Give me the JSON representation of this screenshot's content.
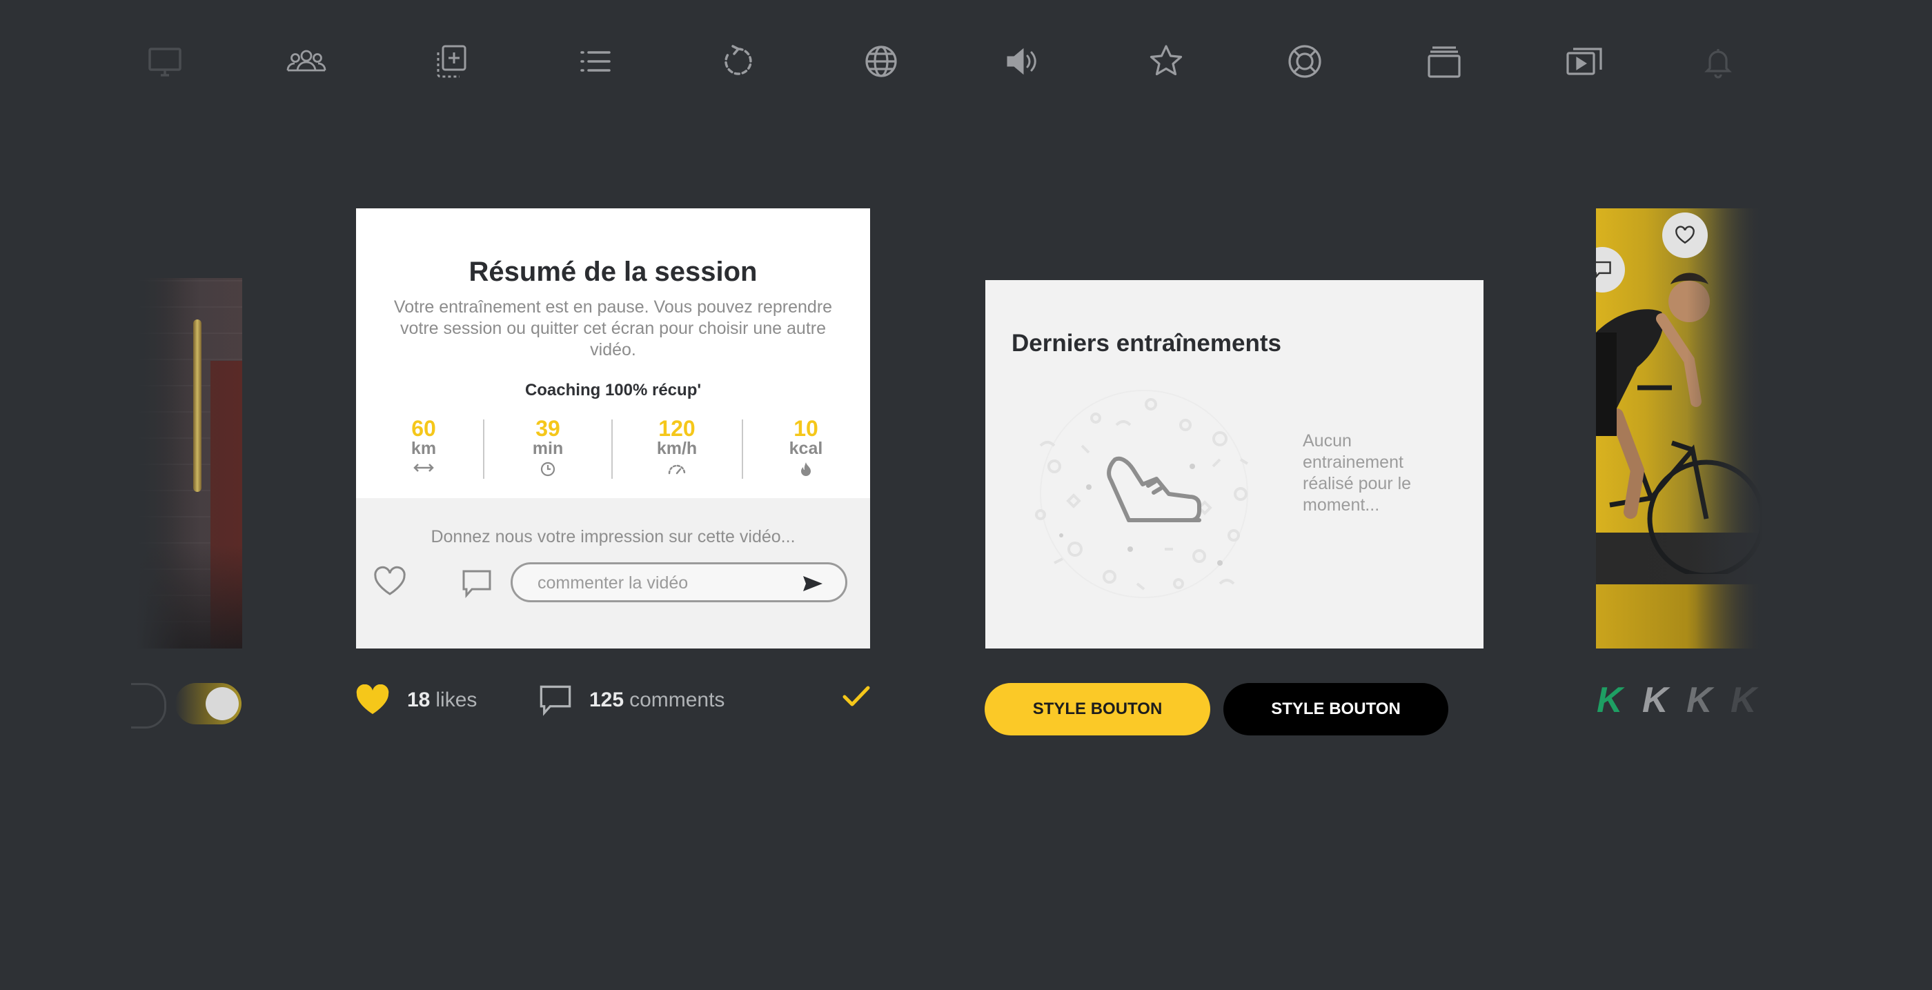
{
  "toolbar": {
    "icons": [
      "monitor-icon",
      "users-icon",
      "add-copy-icon",
      "list-icon",
      "refresh-icon",
      "globe-icon",
      "volume-icon",
      "star-icon",
      "lifebuoy-icon",
      "stack-icon",
      "playlist-icon",
      "bell-icon"
    ]
  },
  "session_card": {
    "title": "Résumé de la session",
    "description": "Votre entraînement est en pause. Vous pouvez reprendre votre session ou quitter cet écran pour choisir une autre vidéo.",
    "coaching": "Coaching 100% récup'",
    "stats": [
      {
        "value": "60",
        "unit": "km",
        "icon": "distance-arrows-icon"
      },
      {
        "value": "39",
        "unit": "min",
        "icon": "clock-icon"
      },
      {
        "value": "120",
        "unit": "km/h",
        "icon": "speed-gauge-icon"
      },
      {
        "value": "10",
        "unit": "kcal",
        "icon": "flame-icon"
      }
    ],
    "feedback_prompt": "Donnez nous votre impression sur cette vidéo...",
    "comment_placeholder": "commenter la vidéo"
  },
  "social": {
    "likes_count": "18",
    "likes_label": "likes",
    "comments_count": "125",
    "comments_label": "comments"
  },
  "trainings_card": {
    "title": "Derniers entraînements",
    "empty_text": "Aucun entrainement réalisé pour le moment..."
  },
  "buttons": {
    "primary_label": "STYLE BOUTON",
    "secondary_label": "STYLE BOUTON"
  },
  "brand": {
    "letters": [
      "K",
      "K",
      "K",
      "K"
    ]
  },
  "colors": {
    "background": "#2e3135",
    "accent_yellow": "#f5c71a",
    "brand_green": "#1e9f63"
  }
}
